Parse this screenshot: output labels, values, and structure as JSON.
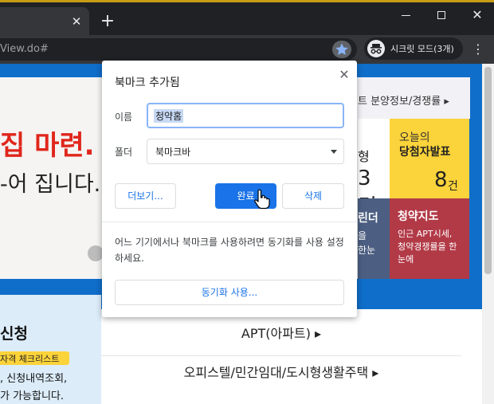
{
  "browser": {
    "tab_close_glyph": "✕",
    "new_tab_glyph": "+",
    "url_text": "View.do#",
    "incognito_label": "시크릿 모드(3개)",
    "window_close_glyph": "✕",
    "menu_glyph": "⋮",
    "accent": "#8ab4f8"
  },
  "page": {
    "hero_title": "집 마련.",
    "hero_sub": "-어 집니다.",
    "info_strip": "트 분양정보/경쟁률 ▸",
    "card_left_label": "형",
    "card_left_num": "3건",
    "card_yellow": {
      "title": "오늘의",
      "subtitle": "당첨자발표",
      "num": "8",
      "unit": "건"
    },
    "card_dark": {
      "title": "린더",
      "line1": "을",
      "line2": "한눈"
    },
    "card_red": {
      "title": "청약지도",
      "line1": "인근 APT시세,",
      "line2": "청약경쟁률을 한",
      "line3": "눈에"
    },
    "apply": {
      "title": "신청",
      "badge": "자격 체크리스트",
      "line1": ", 신청내역조회,",
      "line2": "가 가능합니다."
    },
    "menu": {
      "apt": "APT(아파트) ▸",
      "officetel": "오피스텔/민간임대/도시형생활주택 ▸"
    }
  },
  "dialog": {
    "title": "북마크 추가됨",
    "close_glyph": "✕",
    "name_label": "이름",
    "name_value": "청약홈",
    "folder_label": "폴더",
    "folder_value": "북마크바",
    "more_button": "더보기...",
    "done_button": "완료",
    "delete_button": "삭제",
    "sync_message": "어느 기기에서나 북마크를 사용하려면 동기화를 사용 설정하세요.",
    "sync_button": "동기화 사용..."
  }
}
